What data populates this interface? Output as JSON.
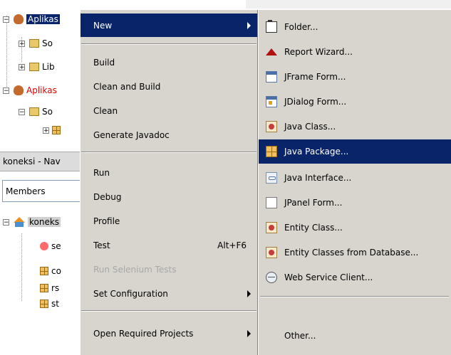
{
  "tree": {
    "nodes": [
      "Aplikas",
      "So",
      "Lib",
      "Aplikas",
      "So"
    ],
    "nav_title": "koneksi - Nav",
    "members": "Members",
    "class_node": "koneks",
    "members_list": [
      "se",
      "co",
      "rs",
      "st"
    ]
  },
  "context_menu": {
    "new": "New",
    "build": "Build",
    "clean_and_build": "Clean and Build",
    "clean": "Clean",
    "generate_javadoc": "Generate Javadoc",
    "run": "Run",
    "debug": "Debug",
    "profile": "Profile",
    "test": "Test",
    "test_shortcut": "Alt+F6",
    "run_selenium": "Run Selenium Tests",
    "set_configuration": "Set Configuration",
    "open_required": "Open Required Projects"
  },
  "submenu": {
    "folder": "Folder...",
    "report_wizard": "Report Wizard...",
    "jframe_form": "JFrame Form...",
    "jdialog_form": "JDialog Form...",
    "java_class": "Java Class...",
    "java_package": "Java Package...",
    "java_interface": "Java Interface...",
    "jpanel_form": "JPanel Form...",
    "entity_class": "Entity Class...",
    "entity_from_db": "Entity Classes from Database...",
    "web_service_client": "Web Service Client...",
    "other": "Other..."
  },
  "colors": {
    "selection": "#0a246a",
    "menu_bg": "#d8d5cf",
    "error_text": "#e00000"
  }
}
